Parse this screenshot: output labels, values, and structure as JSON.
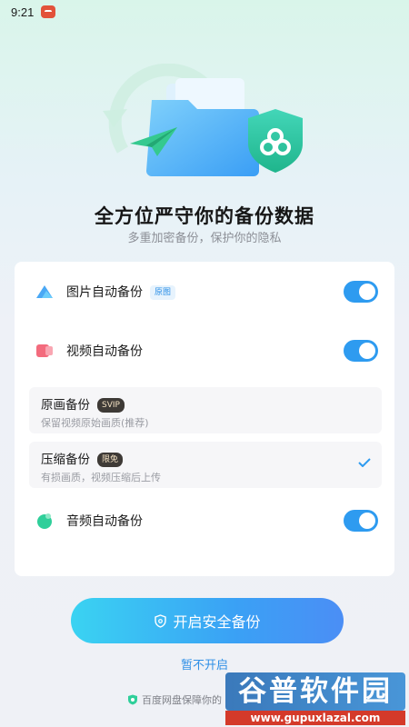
{
  "status_bar": {
    "time": "9:21"
  },
  "header": {
    "title": "全方位严守你的备份数据",
    "subtitle": "多重加密备份，保护你的隐私"
  },
  "backup_options": {
    "photo": {
      "label": "图片自动备份",
      "tag": "原图",
      "enabled": true
    },
    "video": {
      "label": "视频自动备份",
      "enabled": true,
      "modes": [
        {
          "title": "原画备份",
          "tag": "SVIP",
          "desc": "保留视频原始画质(推荐)",
          "selected": false
        },
        {
          "title": "压缩备份",
          "tag": "限免",
          "desc": "有损画质，视频压缩后上传",
          "selected": true
        }
      ]
    },
    "audio": {
      "label": "音频自动备份",
      "enabled": true
    }
  },
  "actions": {
    "primary_label": "开启安全备份",
    "secondary_label": "暂不开启"
  },
  "footer": {
    "note": "百度网盘保障你的"
  },
  "watermark": {
    "brand": "谷普软件园",
    "url": "www.gupuxlazal.com"
  },
  "colors": {
    "accent": "#2e9bf0",
    "toggle_on": "#2e9bf0",
    "button_gradient_start": "#3ad3f2",
    "button_gradient_end": "#4b8ef5",
    "tag_dark": "#3e3a36"
  }
}
